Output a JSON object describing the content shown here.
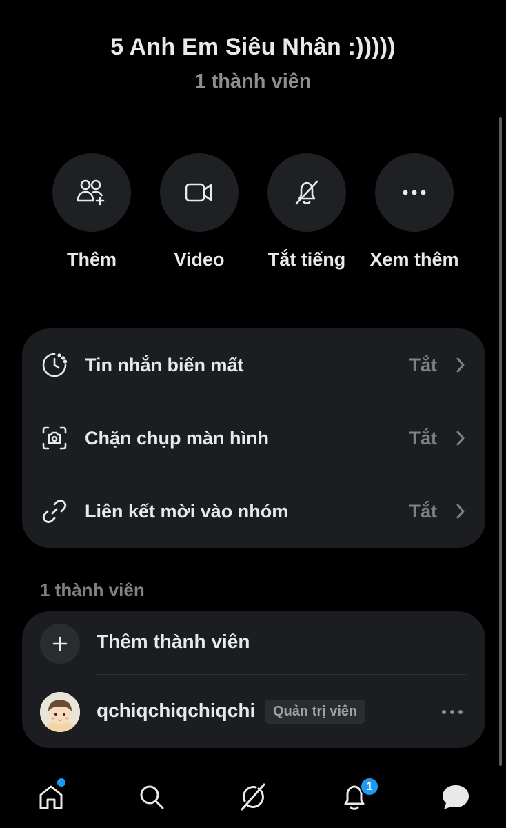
{
  "header": {
    "group_name": "5 Anh Em Siêu Nhân :)))))",
    "member_count": "1 thành viên"
  },
  "actions": [
    {
      "label": "Thêm",
      "icon": "add-people-icon"
    },
    {
      "label": "Video",
      "icon": "video-camera-icon"
    },
    {
      "label": "Tắt tiếng",
      "icon": "bell-muted-icon"
    },
    {
      "label": "Xem thêm",
      "icon": "more-horizontal-icon"
    }
  ],
  "settings": [
    {
      "title": "Tin nhắn biến mất",
      "value": "Tắt",
      "icon": "timer-icon"
    },
    {
      "title": "Chặn chụp màn hình",
      "value": "Tắt",
      "icon": "screenshot-block-icon"
    },
    {
      "title": "Liên kết mời vào nhóm",
      "value": "Tắt",
      "icon": "link-icon"
    }
  ],
  "members_section": {
    "label": "1 thành viên",
    "add_label": "Thêm thành viên",
    "members": [
      {
        "username": "qchiqchiqchiqchi",
        "role": "Quản trị viên"
      }
    ]
  },
  "tabbar": {
    "items": [
      "home-icon",
      "search-icon",
      "grok-icon",
      "notifications-icon",
      "messages-icon"
    ],
    "notification_count": "1"
  },
  "colors": {
    "background": "#000000",
    "card": "#1c1d20",
    "accent": "#1d9bf0",
    "muted_text": "#7e8287"
  }
}
